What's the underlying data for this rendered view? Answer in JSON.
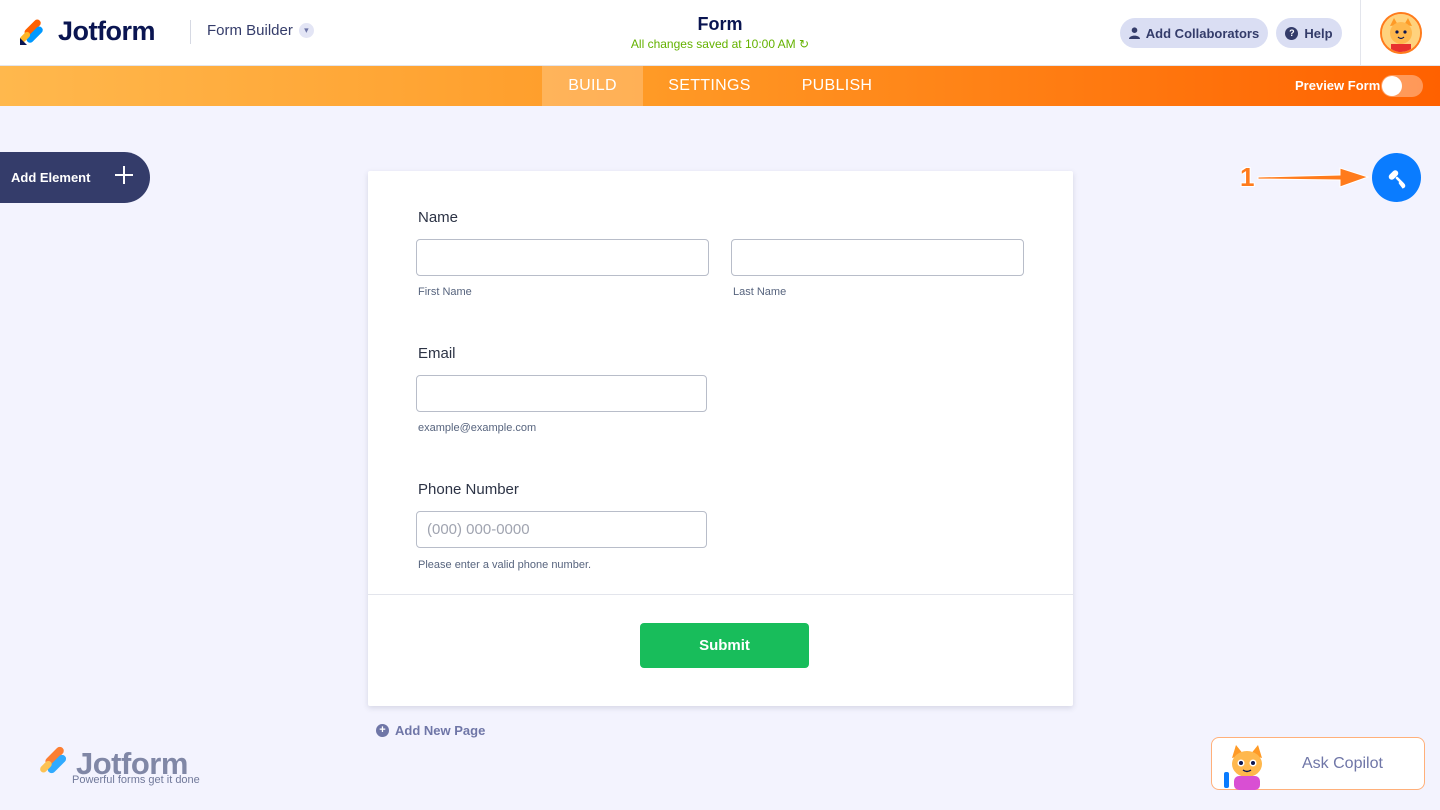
{
  "header": {
    "brand": "Jotform",
    "builder_menu": "Form Builder",
    "form_title": "Form",
    "save_status": "All changes saved at 10:00 AM",
    "collaborators": "Add Collaborators",
    "help": "Help"
  },
  "nav": {
    "tabs": [
      "BUILD",
      "SETTINGS",
      "PUBLISH"
    ],
    "active_tab": "BUILD",
    "preview": "Preview Form",
    "preview_enabled": false
  },
  "sidebar": {
    "add_element": "Add Element"
  },
  "form": {
    "name_label": "Name",
    "first_name": "First Name",
    "last_name": "Last Name",
    "email_label": "Email",
    "email_sublabel": "example@example.com",
    "phone_label": "Phone Number",
    "phone_placeholder": "(000) 000-0000",
    "phone_sublabel": "Please enter a valid phone number.",
    "submit": "Submit"
  },
  "add_page": "Add New Page",
  "annotation": {
    "number": "1"
  },
  "watermark": {
    "brand": "Jotform",
    "tagline": "Powerful forms get it done"
  },
  "copilot": {
    "label": "Ask Copilot"
  },
  "colors": {
    "accent_orange": "#ff6100",
    "primary_blue": "#0a7cff",
    "submit_green": "#18bd5b",
    "navy": "#0a1551"
  },
  "icons": [
    "collaborator-icon",
    "help-icon",
    "chevron-down-icon",
    "refresh-icon",
    "plus-icon",
    "paint-roller-icon",
    "arrow-icon"
  ]
}
